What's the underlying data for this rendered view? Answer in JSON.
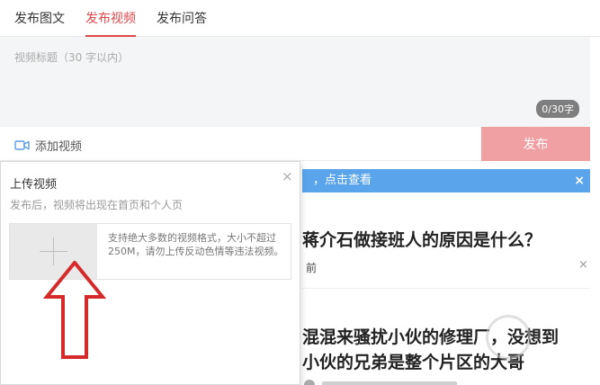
{
  "tabs": [
    {
      "label": "发布图文",
      "active": false
    },
    {
      "label": "发布视频",
      "active": true
    },
    {
      "label": "发布问答",
      "active": false
    }
  ],
  "title_input": {
    "placeholder": "视频标题（30 字以内）",
    "char_count": "0/30字"
  },
  "toolbar": {
    "add_video_label": "添加视频",
    "publish_label": "发布"
  },
  "popup": {
    "title": "上传视频",
    "subtitle": "发布后，视频将出现在首页和个人页",
    "description": "支持绝大多数的视频格式，大小不超过250M，请勿上传反动色情等违法视频。",
    "close": "×"
  },
  "feed": {
    "notice": "，点击查看",
    "notice_close": "×",
    "item1_title": "蒋介石做接班人的原因是什么？",
    "item1_meta": "前",
    "item1_close": "×",
    "item2_line1": "混混来骚扰小伙的修理厂，没想到",
    "item2_line2": "小伙的兄弟是整个片区的大哥"
  },
  "colors": {
    "accent": "#e0474b",
    "publish_bg": "#f0a0a3",
    "notice_bg": "#5aa4ec",
    "arrow": "#d42a2a"
  }
}
